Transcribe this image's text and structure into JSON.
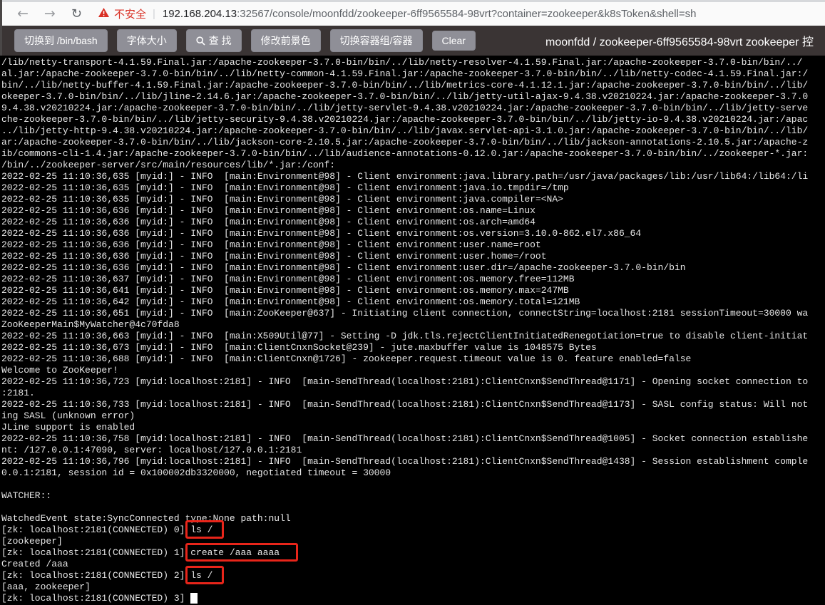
{
  "browser": {
    "back_icon": "←",
    "forward_icon": "→",
    "reload_icon": "↻",
    "warning_label": "不安全",
    "separator": "|",
    "url_host": "192.168.204.13",
    "url_rest": ":32567/console/moonfdd/zookeeper-6ff9565584-98vrt?container=zookeeper&k8sToken&shell=sh"
  },
  "toolbar": {
    "buttons": [
      {
        "label": "切换到 /bin/bash"
      },
      {
        "label": "字体大小"
      },
      {
        "label": "查 找",
        "icon": "search-icon"
      },
      {
        "label": "修改前景色"
      },
      {
        "label": "切换容器组/容器"
      },
      {
        "label": "Clear"
      }
    ],
    "title": "moonfdd / zookeeper-6ff9565584-98vrt zookeeper 控"
  },
  "colors": {
    "warning_red": "#d93025",
    "annotation_red": "#e8251a",
    "toolbar_bg": "#3a3434",
    "button_bg": "#8f8f97",
    "terminal_bg": "#000000",
    "terminal_fg": "#e6e6e6"
  },
  "terminal": {
    "lines": [
      {
        "text": "/lib/netty-transport-4.1.59.Final.jar:/apache-zookeeper-3.7.0-bin/bin/../lib/netty-resolver-4.1.59.Final.jar:/apache-zookeeper-3.7.0-bin/bin/../"
      },
      {
        "text": "al.jar:/apache-zookeeper-3.7.0-bin/bin/../lib/netty-common-4.1.59.Final.jar:/apache-zookeeper-3.7.0-bin/bin/../lib/netty-codec-4.1.59.Final.jar:/"
      },
      {
        "text": "bin/../lib/netty-buffer-4.1.59.Final.jar:/apache-zookeeper-3.7.0-bin/bin/../lib/metrics-core-4.1.12.1.jar:/apache-zookeeper-3.7.0-bin/bin/../lib/"
      },
      {
        "text": "okeeper-3.7.0-bin/bin/../lib/jline-2.14.6.jar:/apache-zookeeper-3.7.0-bin/bin/../lib/jetty-util-ajax-9.4.38.v20210224.jar:/apache-zookeeper-3.7.0"
      },
      {
        "text": "9.4.38.v20210224.jar:/apache-zookeeper-3.7.0-bin/bin/../lib/jetty-servlet-9.4.38.v20210224.jar:/apache-zookeeper-3.7.0-bin/bin/../lib/jetty-serve"
      },
      {
        "text": "che-zookeeper-3.7.0-bin/bin/../lib/jetty-security-9.4.38.v20210224.jar:/apache-zookeeper-3.7.0-bin/bin/../lib/jetty-io-9.4.38.v20210224.jar:/apac"
      },
      {
        "text": "../lib/jetty-http-9.4.38.v20210224.jar:/apache-zookeeper-3.7.0-bin/bin/../lib/javax.servlet-api-3.1.0.jar:/apache-zookeeper-3.7.0-bin/bin/../lib/"
      },
      {
        "text": "ar:/apache-zookeeper-3.7.0-bin/bin/../lib/jackson-core-2.10.5.jar:/apache-zookeeper-3.7.0-bin/bin/../lib/jackson-annotations-2.10.5.jar:/apache-z"
      },
      {
        "text": "ib/commons-cli-1.4.jar:/apache-zookeeper-3.7.0-bin/bin/../lib/audience-annotations-0.12.0.jar:/apache-zookeeper-3.7.0-bin/bin/../zookeeper-*.jar:"
      },
      {
        "text": "/bin/../zookeeper-server/src/main/resources/lib/*.jar:/conf:"
      },
      {
        "text": "2022-02-25 11:10:36,635 [myid:] - INFO  [main:Environment@98] - Client environment:java.library.path=/usr/java/packages/lib:/usr/lib64:/lib64:/li"
      },
      {
        "text": "2022-02-25 11:10:36,635 [myid:] - INFO  [main:Environment@98] - Client environment:java.io.tmpdir=/tmp"
      },
      {
        "text": "2022-02-25 11:10:36,635 [myid:] - INFO  [main:Environment@98] - Client environment:java.compiler=<NA>"
      },
      {
        "text": "2022-02-25 11:10:36,636 [myid:] - INFO  [main:Environment@98] - Client environment:os.name=Linux"
      },
      {
        "text": "2022-02-25 11:10:36,636 [myid:] - INFO  [main:Environment@98] - Client environment:os.arch=amd64"
      },
      {
        "text": "2022-02-25 11:10:36,636 [myid:] - INFO  [main:Environment@98] - Client environment:os.version=3.10.0-862.el7.x86_64"
      },
      {
        "text": "2022-02-25 11:10:36,636 [myid:] - INFO  [main:Environment@98] - Client environment:user.name=root"
      },
      {
        "text": "2022-02-25 11:10:36,636 [myid:] - INFO  [main:Environment@98] - Client environment:user.home=/root"
      },
      {
        "text": "2022-02-25 11:10:36,636 [myid:] - INFO  [main:Environment@98] - Client environment:user.dir=/apache-zookeeper-3.7.0-bin/bin"
      },
      {
        "text": "2022-02-25 11:10:36,637 [myid:] - INFO  [main:Environment@98] - Client environment:os.memory.free=112MB"
      },
      {
        "text": "2022-02-25 11:10:36,641 [myid:] - INFO  [main:Environment@98] - Client environment:os.memory.max=247MB"
      },
      {
        "text": "2022-02-25 11:10:36,642 [myid:] - INFO  [main:Environment@98] - Client environment:os.memory.total=121MB"
      },
      {
        "text": "2022-02-25 11:10:36,651 [myid:] - INFO  [main:ZooKeeper@637] - Initiating client connection, connectString=localhost:2181 sessionTimeout=30000 wa"
      },
      {
        "text": "ZooKeeperMain$MyWatcher@4c70fda8"
      },
      {
        "text": "2022-02-25 11:10:36,663 [myid:] - INFO  [main:X509Util@77] - Setting -D jdk.tls.rejectClientInitiatedRenegotiation=true to disable client-initiat"
      },
      {
        "text": "2022-02-25 11:10:36,673 [myid:] - INFO  [main:ClientCnxnSocket@239] - jute.maxbuffer value is 1048575 Bytes"
      },
      {
        "text": "2022-02-25 11:10:36,688 [myid:] - INFO  [main:ClientCnxn@1726] - zookeeper.request.timeout value is 0. feature enabled=false"
      },
      {
        "text": "Welcome to ZooKeeper!"
      },
      {
        "text": "2022-02-25 11:10:36,723 [myid:localhost:2181] - INFO  [main-SendThread(localhost:2181):ClientCnxn$SendThread@1171] - Opening socket connection to"
      },
      {
        "text": ":2181."
      },
      {
        "text": "2022-02-25 11:10:36,733 [myid:localhost:2181] - INFO  [main-SendThread(localhost:2181):ClientCnxn$SendThread@1173] - SASL config status: Will not"
      },
      {
        "text": "ing SASL (unknown error)"
      },
      {
        "text": "JLine support is enabled"
      },
      {
        "text": "2022-02-25 11:10:36,758 [myid:localhost:2181] - INFO  [main-SendThread(localhost:2181):ClientCnxn$SendThread@1005] - Socket connection establishe"
      },
      {
        "text": "nt: /127.0.0.1:47090, server: localhost/127.0.0.1:2181"
      },
      {
        "text": "2022-02-25 11:10:36,796 [myid:localhost:2181] - INFO  [main-SendThread(localhost:2181):ClientCnxn$SendThread@1438] - Session establishment comple"
      },
      {
        "text": "0.0.1:2181, session id = 0x100002db3320000, negotiated timeout = 30000"
      },
      {
        "text": ""
      },
      {
        "text": "WATCHER::"
      },
      {
        "text": ""
      },
      {
        "text": "WatchedEvent state:SyncConnected type:None path:null"
      },
      {
        "prompt": "[zk: localhost:2181(CONNECTED) 0] ",
        "command": "ls /",
        "annotated": true
      },
      {
        "text": "[zookeeper]"
      },
      {
        "prompt": "[zk: localhost:2181(CONNECTED) 1] ",
        "command": "create /aaa aaaa",
        "annotated": true,
        "wide": true
      },
      {
        "text": "Created /aaa"
      },
      {
        "prompt": "[zk: localhost:2181(CONNECTED) 2] ",
        "command": "ls /",
        "annotated": true
      },
      {
        "text": "[aaa, zookeeper]"
      },
      {
        "prompt": "[zk: localhost:2181(CONNECTED) 3] ",
        "cursor": true
      }
    ]
  }
}
